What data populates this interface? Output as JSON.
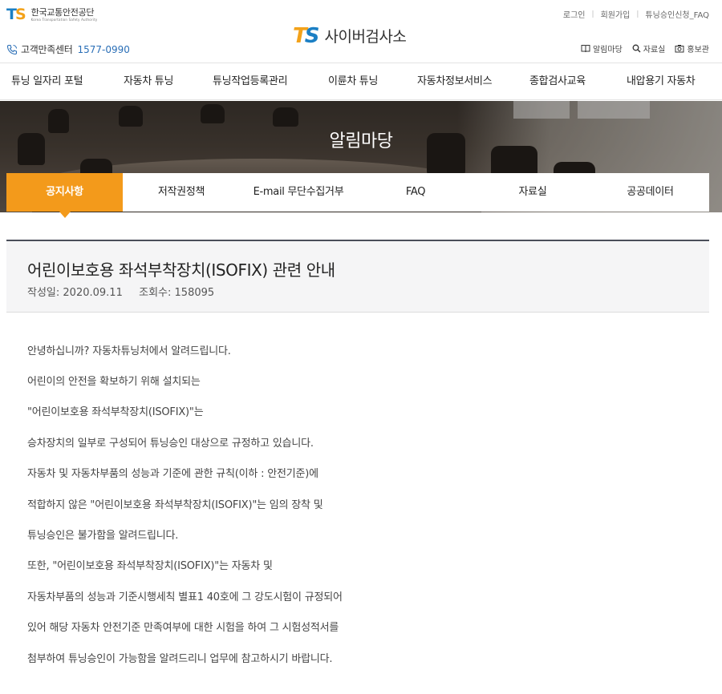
{
  "header": {
    "org_name": "한국교통안전공단",
    "org_name_en": "Korea Transportation Safety Authority",
    "org_mark": "TS",
    "call_center_label": "고객만족센터",
    "call_center_number": "1577-0990",
    "site_mark": "TS",
    "site_name": "사이버검사소",
    "util_links": [
      "로그인",
      "회원가입",
      "튜닝승인신청_FAQ"
    ],
    "quick_links": [
      {
        "label": "알림마당",
        "icon": "book-icon"
      },
      {
        "label": "자료실",
        "icon": "search-icon"
      },
      {
        "label": "홍보관",
        "icon": "camera-icon"
      }
    ]
  },
  "gnb": [
    "튜닝 일자리 포털",
    "자동차 튜닝",
    "튜닝작업등록관리",
    "이륜차 튜닝",
    "자동차정보서비스",
    "종합검사교육",
    "내압용기 자동차"
  ],
  "banner": {
    "title": "알림마당"
  },
  "subtabs": [
    "공지사항",
    "저작권정책",
    "E-mail 무단수집거부",
    "FAQ",
    "자료실",
    "공공데이터"
  ],
  "active_subtab": "공지사항",
  "article": {
    "title": "어린이보호용 좌석부착장치(ISOFIX) 관련 안내",
    "date_label": "작성일:",
    "date": "2020.09.11",
    "views_label": "조회수:",
    "views": "158095",
    "body": [
      "안녕하십니까? 자동차튜닝처에서 알려드립니다.",
      "어린이의 안전을 확보하기 위해 설치되는",
      "\"어린이보호용 좌석부착장치(ISOFIX)\"는",
      "승차장치의 일부로 구성되어 튜닝승인 대상으로 규정하고 있습니다.",
      "자동차 및 자동차부품의 성능과 기준에 관한 규칙(이하 : 안전기준)에",
      "적합하지 않은 \"어린이보호용 좌석부착장치(ISOFIX)\"는 임의 장착 및",
      "튜닝승인은 불가함을 알려드립니다.",
      "또한, \"어린이보호용 좌석부착장치(ISOFIX)\"는 자동차 및",
      "자동차부품의 성능과 기준시행세칙 별표1 40호에 그 강도시험이 규정되어",
      "있어 해당 자동차 안전기준 만족여부에 대한 시험을 하여 그 시험성적서를",
      "첨부하여 튜닝승인이 가능함을 알려드리니 업무에 참고하시기 바랍니다."
    ]
  },
  "colors": {
    "accent_orange": "#f39a1b",
    "brand_blue": "#1b7fc4",
    "phone_blue": "#2b6fb7",
    "head_border": "#4a4f5a"
  }
}
